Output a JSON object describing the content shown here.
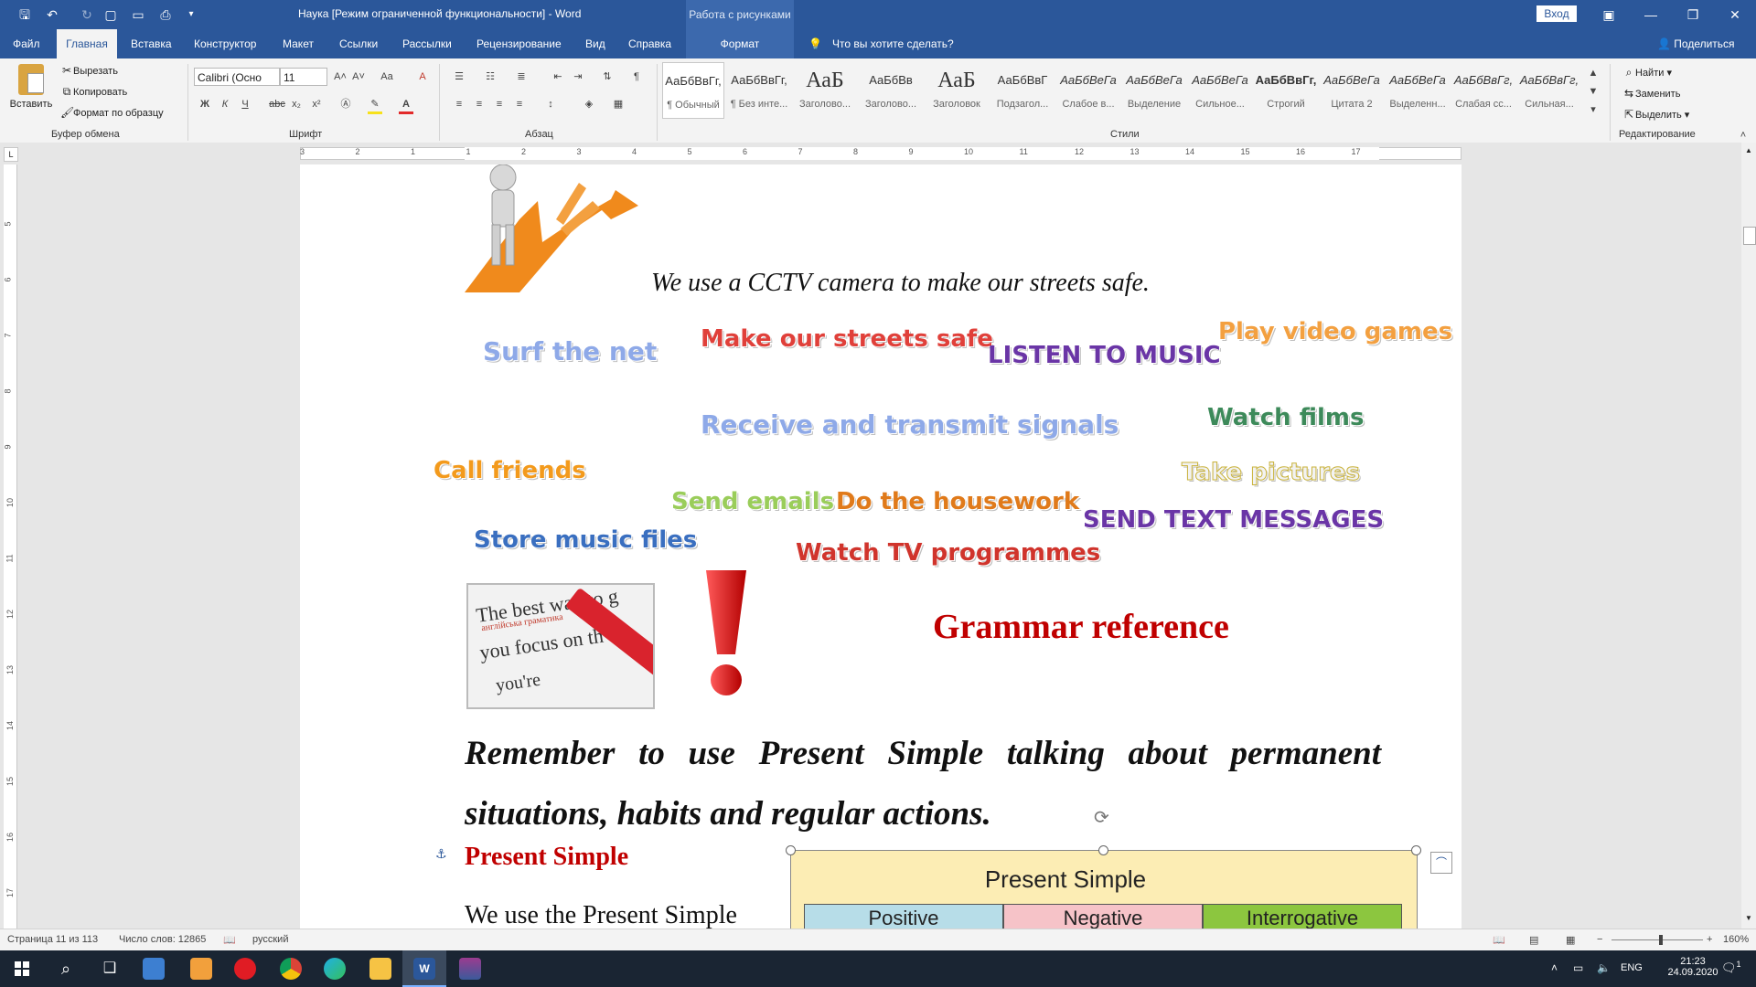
{
  "window": {
    "title": "Наука [Режим ограниченной функциональности] - Word",
    "context_group": "Работа с рисунками",
    "signin": "Вход"
  },
  "tabs": [
    "Файл",
    "Главная",
    "Вставка",
    "Конструктор",
    "Макет",
    "Ссылки",
    "Рассылки",
    "Рецензирование",
    "Вид",
    "Справка"
  ],
  "context_tab": "Формат",
  "tellme": "Что вы хотите сделать?",
  "share": "Поделиться",
  "ribbon": {
    "clipboard": {
      "paste": "Вставить",
      "cut": "Вырезать",
      "copy": "Копировать",
      "format_painter": "Формат по образцу",
      "label": "Буфер обмена"
    },
    "font": {
      "name": "Calibri (Осно",
      "size": "11",
      "label": "Шрифт",
      "bold": "Ж",
      "italic": "К",
      "underline": "Ч",
      "strike": "abc",
      "sub": "x₂",
      "sup": "x²",
      "grow": "A˄",
      "shrink": "A˅",
      "case": "Aa",
      "clear": "A"
    },
    "paragraph": {
      "label": "Абзац"
    },
    "styles": {
      "label": "Стили",
      "items": [
        {
          "preview": "АаБбВвГг,",
          "name": "¶ Обычный"
        },
        {
          "preview": "АаБбВвГг,",
          "name": "¶ Без инте..."
        },
        {
          "preview": "АаБ",
          "name": "Заголово..."
        },
        {
          "preview": "АаБбВв",
          "name": "Заголово..."
        },
        {
          "preview": "АаБ",
          "name": "Заголовок"
        },
        {
          "preview": "АаБбВвГ",
          "name": "Подзагол..."
        },
        {
          "preview": "АаБбВеГа",
          "name": "Слабое в..."
        },
        {
          "preview": "АаБбВеГа",
          "name": "Выделение"
        },
        {
          "preview": "АаБбВеГа",
          "name": "Сильное..."
        },
        {
          "preview": "АаБбВвГг,",
          "name": "Строгий"
        },
        {
          "preview": "АаБбВеГа",
          "name": "Цитата 2"
        },
        {
          "preview": "АаБбВеГа",
          "name": "Выделенн..."
        },
        {
          "preview": "АаБбВвГг,",
          "name": "Слабая сс..."
        },
        {
          "preview": "АаБбВвГг,",
          "name": "Сильная..."
        }
      ]
    },
    "editing": {
      "find": "Найти",
      "replace": "Заменить",
      "select": "Выделить",
      "label": "Редактирование"
    }
  },
  "ruler_numbers": [
    "3",
    "2",
    "1",
    "1",
    "2",
    "3",
    "4",
    "5",
    "6",
    "7",
    "8",
    "9",
    "10",
    "11",
    "12",
    "13",
    "14",
    "15",
    "16",
    "17"
  ],
  "vruler_numbers": [
    "5",
    "6",
    "7",
    "8",
    "9",
    "10",
    "11",
    "12",
    "13",
    "14",
    "15",
    "16",
    "17"
  ],
  "document": {
    "caption": "We use a CCTV camera to make our streets safe.",
    "wordart": [
      {
        "text": "Surf the net",
        "color": "#8ea9e8"
      },
      {
        "text": "Make our streets safe",
        "color": "#e0403a"
      },
      {
        "text": "LISTEN TO MUSIC",
        "color": "#6a35a6"
      },
      {
        "text": "Play video games",
        "color": "#f3a040"
      },
      {
        "text": "Receive and transmit signals",
        "color": "#8ea9e8"
      },
      {
        "text": "Watch films",
        "color": "#3d8a5a"
      },
      {
        "text": "Call friends",
        "color": "#f39a1c"
      },
      {
        "text": "Take pictures",
        "color": "#f2f2f2"
      },
      {
        "text": "Send emails",
        "color": "#9acd5a"
      },
      {
        "text": "Do the housework",
        "color": "#e07a1a"
      },
      {
        "text": "SEND TEXT MESSAGES",
        "color": "#6a35a6"
      },
      {
        "text": "Store music files",
        "color": "#3a6fc0"
      },
      {
        "text": "Watch TV programmes",
        "color": "#d0342c"
      }
    ],
    "photo_lines": [
      "The best way to g",
      "англійська граматика",
      "you focus on th",
      "you're"
    ],
    "grammar_heading": "Grammar reference",
    "remember": "Remember to use Present Simple talking about permanent situations, habits and regular actions.",
    "ps_heading": "Present Simple",
    "body_start": "We use the Present Simple",
    "table": {
      "title": "Present Simple",
      "headers": [
        {
          "text": "Positive",
          "color": "#b7dde8"
        },
        {
          "text": "Negative",
          "color": "#f6c3c8"
        },
        {
          "text": "Interrogative",
          "color": "#8cc63f"
        }
      ]
    }
  },
  "status": {
    "page": "Страница 11 из 113",
    "words": "Число слов: 12865",
    "lang": "русский",
    "zoom": "160%"
  },
  "taskbar": {
    "lang": "ENG",
    "time": "21:23",
    "date": "24.09.2020",
    "notif": "1"
  }
}
